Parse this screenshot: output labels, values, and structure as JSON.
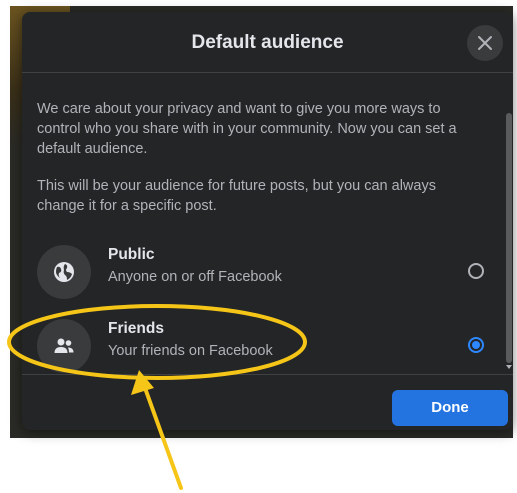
{
  "dialog": {
    "title": "Default audience",
    "intro": "We care about your privacy and want to give you more ways to control who you share with in your community. Now you can set a default audience.",
    "note": "This will be your audience for future posts, but you can always change it for a specific post.",
    "done_label": "Done"
  },
  "options": [
    {
      "title": "Public",
      "description": "Anyone on or off Facebook",
      "icon": "globe-icon",
      "selected": false
    },
    {
      "title": "Friends",
      "description": "Your friends on Facebook",
      "icon": "friends-icon",
      "selected": true
    }
  ],
  "colors": {
    "accent": "#2374e1",
    "highlight": "#f5c518",
    "dialog_bg": "#242526"
  }
}
